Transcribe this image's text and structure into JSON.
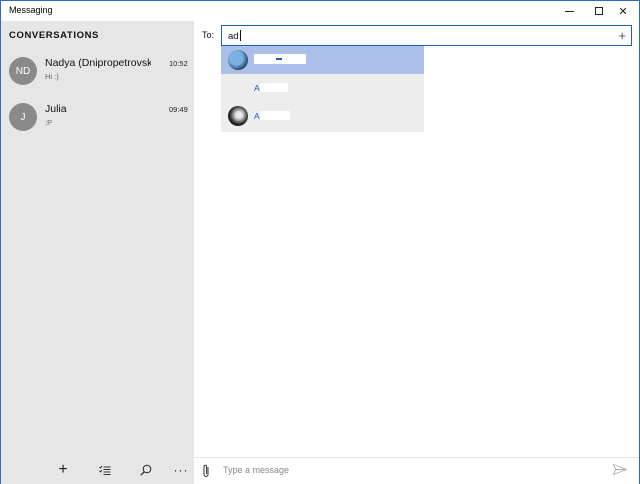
{
  "window": {
    "title": "Messaging"
  },
  "sidebar": {
    "heading": "CONVERSATIONS",
    "conversations": [
      {
        "initials": "ND",
        "name": "Nadya (Dnipropetrovsk)",
        "snippet": "Hi :)",
        "time": "10:52"
      },
      {
        "initials": "J",
        "name": "Julia",
        "snippet": ";P",
        "time": "09:49"
      }
    ],
    "bottom_icons": [
      "plus-icon",
      "select-list-icon",
      "search-icon",
      "more-icon"
    ]
  },
  "main": {
    "to_label": "To:",
    "to_value": "ad",
    "suggestions": [
      {
        "label": ""
      },
      {
        "label": "A"
      },
      {
        "label": "A"
      }
    ],
    "compose_placeholder": "Type a message"
  },
  "colors": {
    "accent": "#1f5fb4",
    "sidebar_bg": "#e6e6e6",
    "selected_suggestion": "#a9bfe7",
    "avatar_gray": "#8a8a8a"
  }
}
